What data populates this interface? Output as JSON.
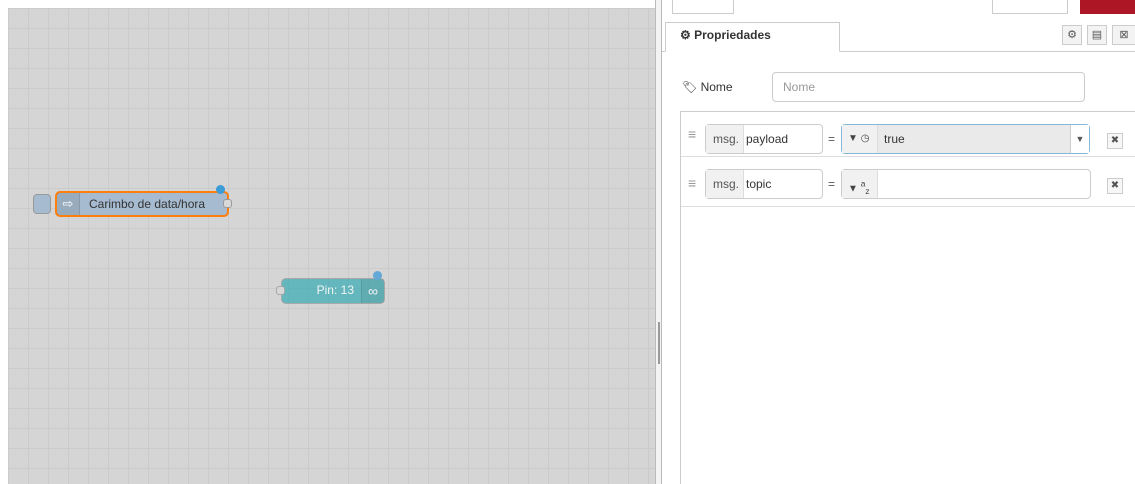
{
  "workspace": {
    "nodes": [
      {
        "label": "Carimbo de data/hora",
        "icon": "arrow-right-icon"
      },
      {
        "label": "Pin: 13",
        "icon": "infinity-icon"
      }
    ]
  },
  "panel": {
    "tab_label": "Propriedades",
    "tab_icon": "gear-icon",
    "name_label": "Nome",
    "name_placeholder": "Nome",
    "name_value": "",
    "rules": [
      {
        "prefix": "msg.",
        "property": "payload",
        "operator": "=",
        "type_icon": "clock-icon",
        "value": "true"
      },
      {
        "prefix": "msg.",
        "property": "topic",
        "operator": "=",
        "type_icon": "az-icon",
        "value": ""
      }
    ]
  },
  "colors": {
    "inject_node": "#a6bbcf",
    "selected_outline": "#ff7f0e",
    "pin_node": "#3fadb5",
    "status_dot": "#3d9bd5",
    "accent_red": "#ad1625"
  }
}
